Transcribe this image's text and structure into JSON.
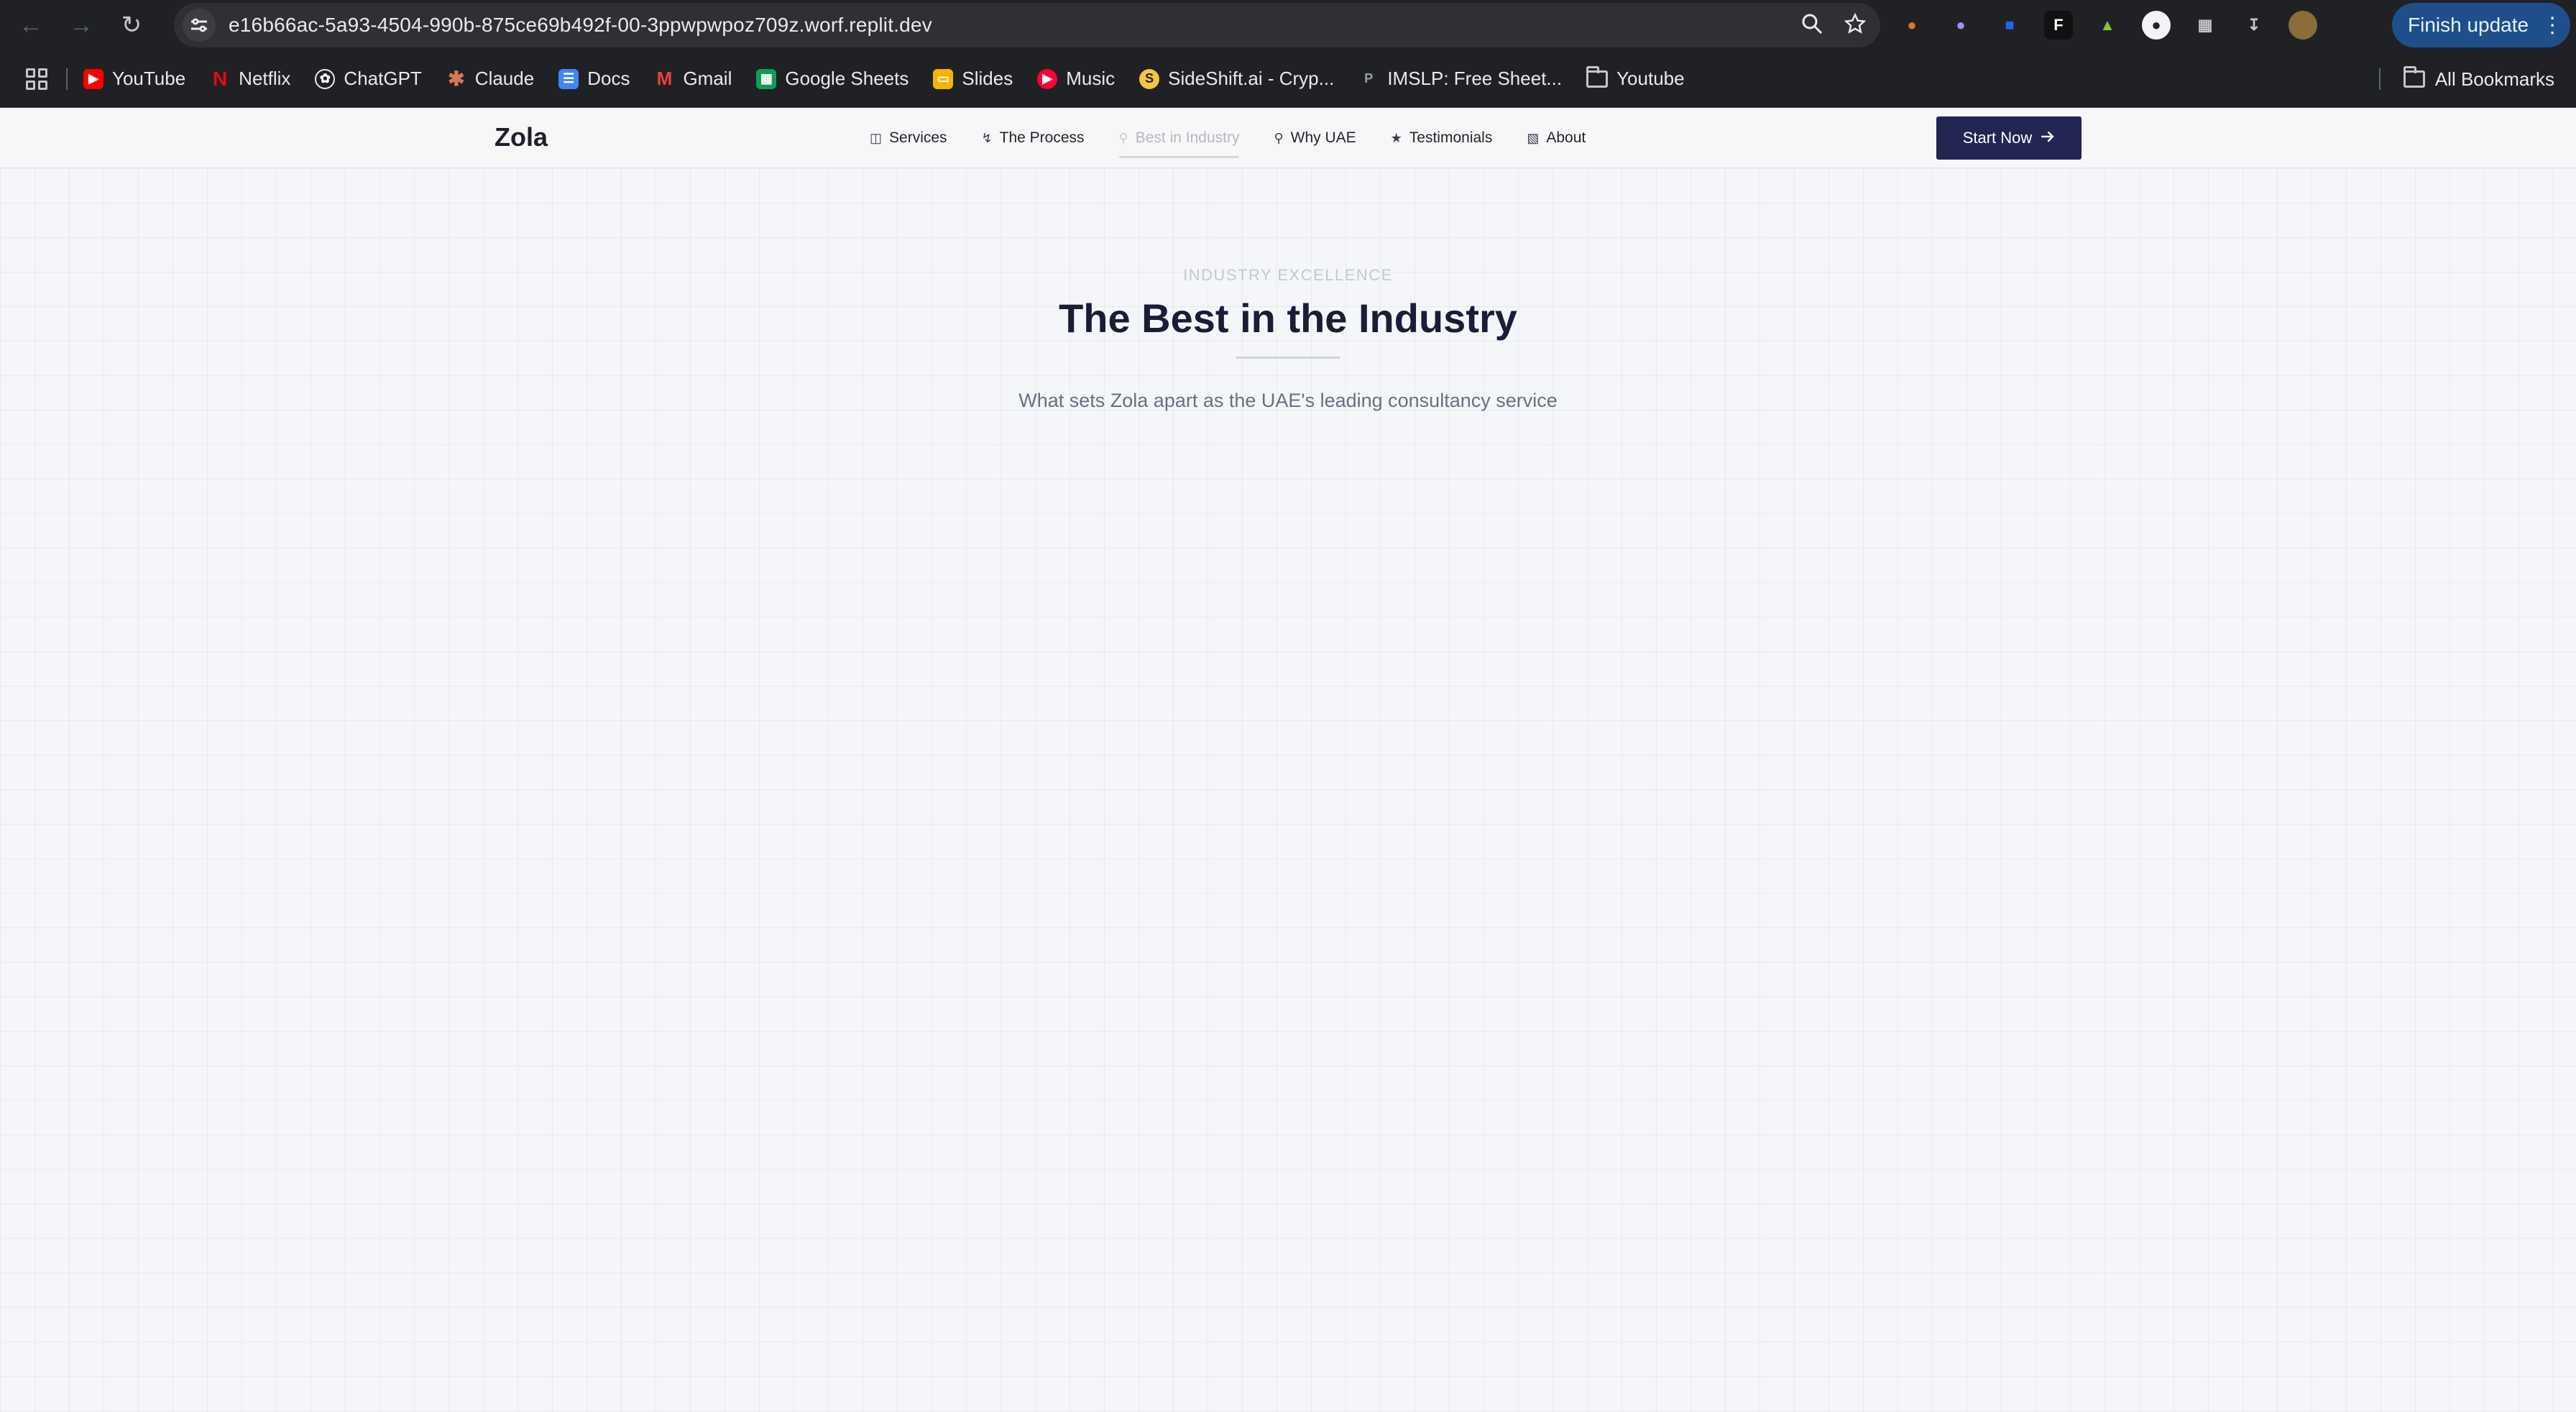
{
  "browser": {
    "url": "e16b66ac-5a93-4504-990b-875ce69b492f-00-3ppwpwpoz709z.worf.replit.dev",
    "finish_update": "Finish update",
    "bookmarks": [
      {
        "label": "YouTube",
        "icon": "youtube-icon",
        "color": "#ff0000"
      },
      {
        "label": "Netflix",
        "icon": "netflix-icon",
        "color": "#e50914"
      },
      {
        "label": "ChatGPT",
        "icon": "chatgpt-icon",
        "color": "#ffffff"
      },
      {
        "label": "Claude",
        "icon": "claude-icon",
        "color": "#d97757"
      },
      {
        "label": "Docs",
        "icon": "docs-icon",
        "color": "#4285f4"
      },
      {
        "label": "Gmail",
        "icon": "gmail-icon",
        "color": "#ea4335"
      },
      {
        "label": "Google Sheets",
        "icon": "sheets-icon",
        "color": "#0f9d58"
      },
      {
        "label": "Slides",
        "icon": "slides-icon",
        "color": "#f4b400"
      },
      {
        "label": "Music",
        "icon": "music-icon",
        "color": "#ff0033"
      },
      {
        "label": "SideShift.ai - Cryp...",
        "icon": "sideshift-icon",
        "color": "#f5c542"
      },
      {
        "label": "IMSLP: Free Sheet...",
        "icon": "imslp-icon",
        "color": "#444444"
      },
      {
        "label": "Youtube",
        "icon": "folder-icon",
        "color": "#c4c7c5"
      }
    ],
    "all_bookmarks": "All Bookmarks"
  },
  "site": {
    "brand": "Zola",
    "nav": [
      {
        "label": "Services",
        "icon": "briefcase-icon"
      },
      {
        "label": "The Process",
        "icon": "workflow-icon"
      },
      {
        "label": "Best in Industry",
        "icon": "award-icon"
      },
      {
        "label": "Why UAE",
        "icon": "map-pin-icon"
      },
      {
        "label": "Testimonials",
        "icon": "star-icon"
      },
      {
        "label": "About",
        "icon": "building-icon"
      }
    ],
    "cta": "Start Now"
  },
  "section": {
    "eyebrow": "INDUSTRY EXCELLENCE",
    "title": "The Best in the Industry",
    "subtitle": "What sets Zola apart as the UAE's leading consultancy service"
  },
  "colors": {
    "accent": "#232552",
    "heading": "#1a1d35",
    "muted": "#6b6f80"
  }
}
